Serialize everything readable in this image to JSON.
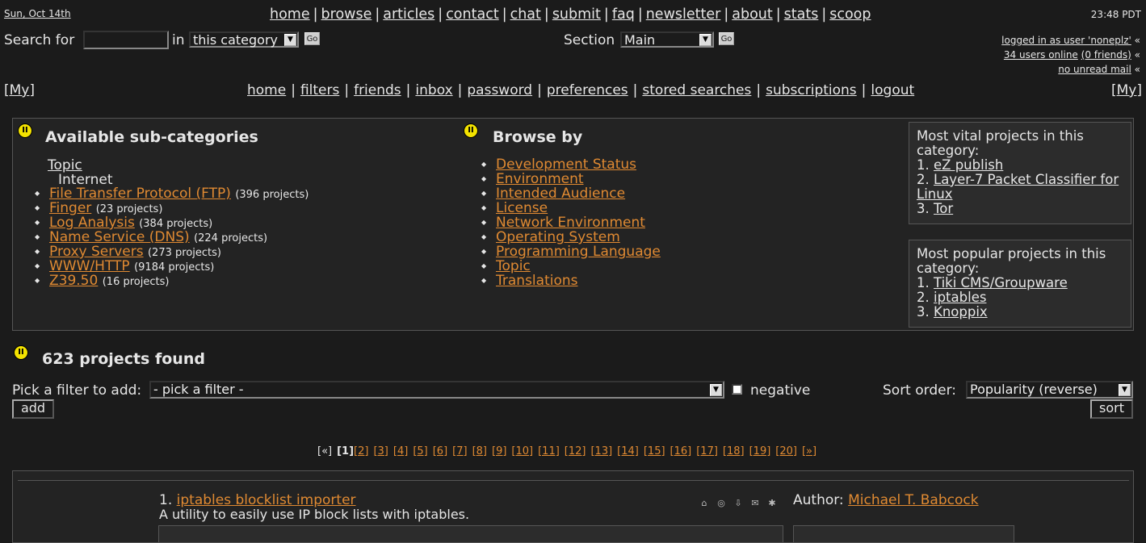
{
  "header": {
    "date": "Sun, Oct 14th",
    "time": "23:48 PDT",
    "nav": [
      "home",
      "browse",
      "articles",
      "contact",
      "chat",
      "submit",
      "faq",
      "newsletter",
      "about",
      "stats",
      "scoop"
    ],
    "search_label": "Search for",
    "in_label": "in",
    "scope_value": "this category",
    "go_label": "Go",
    "section_label": "Section",
    "section_value": "Main",
    "logged_in": "logged in as user 'noneplz'",
    "users_online": "34 users online",
    "friends": "(0 friends)",
    "mail": "no unread mail",
    "chevron": "«"
  },
  "subnav": {
    "my_label": "[My]",
    "items": [
      "home",
      "filters",
      "friends",
      "inbox",
      "password",
      "preferences",
      "stored searches",
      "subscriptions",
      "logout"
    ]
  },
  "subcats": {
    "heading": "Available sub-categories",
    "topic_label": "Topic",
    "topic_value": "Internet",
    "items": [
      {
        "label": "File Transfer Protocol (FTP)",
        "count": "(396 projects)"
      },
      {
        "label": "Finger",
        "count": "(23 projects)"
      },
      {
        "label": "Log Analysis",
        "count": "(384 projects)"
      },
      {
        "label": "Name Service (DNS)",
        "count": "(224 projects)"
      },
      {
        "label": "Proxy Servers",
        "count": "(273 projects)"
      },
      {
        "label": "WWW/HTTP",
        "count": "(9184 projects)"
      },
      {
        "label": "Z39.50",
        "count": "(16 projects)"
      }
    ]
  },
  "browse": {
    "heading": "Browse by",
    "items": [
      "Development Status",
      "Environment",
      "Intended Audience",
      "License",
      "Network Environment",
      "Operating System",
      "Programming Language",
      "Topic",
      "Translations"
    ]
  },
  "vital": {
    "heading": "Most vital projects in this category:",
    "items": [
      {
        "num": "1.",
        "label": "eZ publish"
      },
      {
        "num": "2.",
        "label": "Layer-7 Packet Classifier for Linux"
      },
      {
        "num": "3.",
        "label": "Tor"
      }
    ]
  },
  "popular": {
    "heading": "Most popular projects in this category:",
    "items": [
      {
        "num": "1.",
        "label": "Tiki CMS/Groupware"
      },
      {
        "num": "2.",
        "label": "iptables"
      },
      {
        "num": "3.",
        "label": "Knoppix"
      }
    ]
  },
  "results": {
    "found": "623 projects found",
    "filter_label": "Pick a filter to add:",
    "filter_value": "- pick a filter -",
    "negative_label": "negative",
    "add_label": "add",
    "sort_label": "Sort order:",
    "sort_value": "Popularity (reverse)",
    "sort_button": "sort"
  },
  "pagination": {
    "prev": "[«]",
    "current": "[1]",
    "pages": [
      "[2]",
      "[3]",
      "[4]",
      "[5]",
      "[6]",
      "[7]",
      "[8]",
      "[9]",
      "[10]",
      "[11]",
      "[12]",
      "[13]",
      "[14]",
      "[15]",
      "[16]",
      "[17]",
      "[18]",
      "[19]",
      "[20]",
      "[»]"
    ]
  },
  "project": {
    "num": "1.",
    "title": "iptables blocklist importer",
    "description": "A utility to easily use IP block lists with iptables.",
    "author_label": "Author:",
    "author": "Michael T. Babcock",
    "icons": [
      "home-icon",
      "globe-icon",
      "download-icon",
      "mail-icon",
      "gear-icon"
    ]
  }
}
